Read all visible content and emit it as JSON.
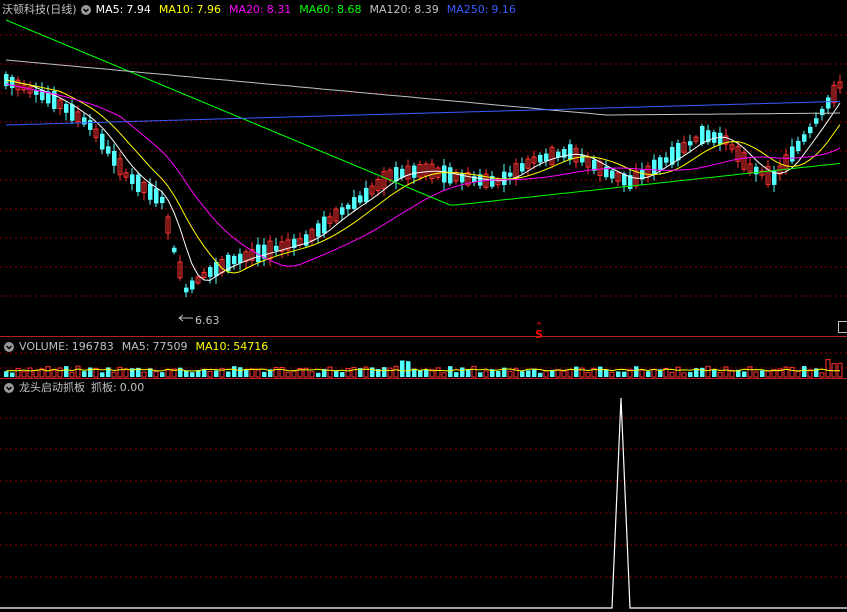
{
  "main_panel": {
    "stock_title": "沃顿科技(日线)",
    "ma": [
      {
        "label": "MA5:",
        "value": "7.94",
        "color": "#ffffff"
      },
      {
        "label": "MA10:",
        "value": "7.96",
        "color": "#ffff00"
      },
      {
        "label": "MA20:",
        "value": "8.31",
        "color": "#ff00ff"
      },
      {
        "label": "MA60:",
        "value": "8.68",
        "color": "#00ff00"
      },
      {
        "label": "MA120:",
        "value": "8.39",
        "color": "#c0c0c0"
      },
      {
        "label": "MA250:",
        "value": "9.16",
        "color": "#3b5bff"
      }
    ],
    "low_marker": "6.63",
    "signal_marker": "S"
  },
  "volume_panel": {
    "label": "VOLUME:",
    "value": "196783",
    "ma5_label": "MA5:",
    "ma5_value": "77509",
    "ma10_label": "MA10:",
    "ma10_value": "54716"
  },
  "indicator_panel": {
    "name": "龙头启动抓板",
    "sub_label": "抓板:",
    "value": "0.00"
  },
  "colors": {
    "up": "#ff3232",
    "down": "#54ffff",
    "grid": "#8b0000",
    "signal": "#ff0000"
  }
}
